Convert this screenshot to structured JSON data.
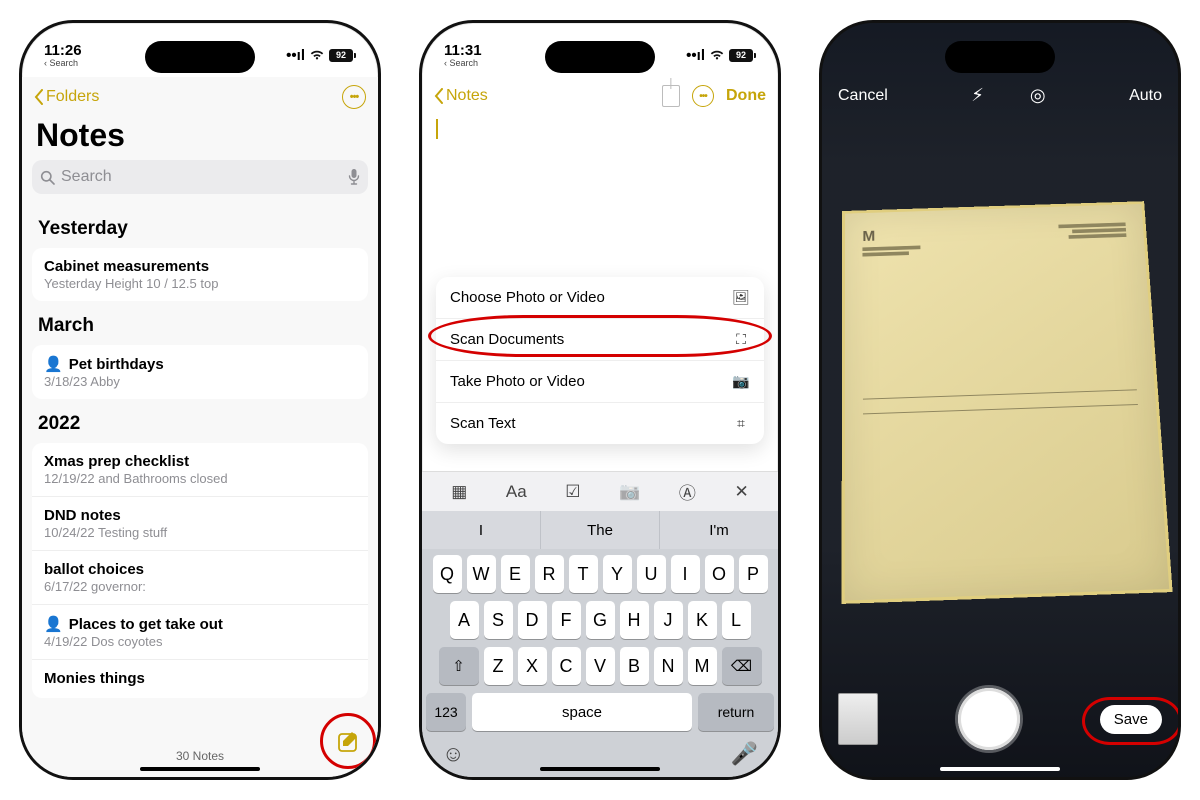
{
  "phone1": {
    "status": {
      "time": "11:26",
      "back_hint": "Search",
      "battery": "92"
    },
    "nav": {
      "back": "Folders"
    },
    "title": "Notes",
    "search_placeholder": "Search",
    "sections": [
      {
        "header": "Yesterday",
        "rows": [
          {
            "title": "Cabinet measurements",
            "sub": "Yesterday  Height 10 / 12.5 top",
            "shared": false
          }
        ]
      },
      {
        "header": "March",
        "rows": [
          {
            "title": "Pet birthdays",
            "sub": "3/18/23  Abby",
            "shared": true
          }
        ]
      },
      {
        "header": "2022",
        "rows": [
          {
            "title": "Xmas prep checklist",
            "sub": "12/19/22  and Bathrooms closed",
            "shared": false
          },
          {
            "title": "DND notes",
            "sub": "10/24/22  Testing stuff",
            "shared": false
          },
          {
            "title": "ballot choices",
            "sub": "6/17/22  governor:",
            "shared": false
          },
          {
            "title": "Places to get take out",
            "sub": "4/19/22  Dos coyotes",
            "shared": true
          },
          {
            "title": "Monies things",
            "sub": "",
            "shared": false
          }
        ]
      }
    ],
    "footer_count": "30 Notes"
  },
  "phone2": {
    "status": {
      "time": "11:31",
      "back_hint": "Search",
      "battery": "92"
    },
    "nav": {
      "back": "Notes",
      "done": "Done"
    },
    "menu": [
      {
        "label": "Choose Photo or Video"
      },
      {
        "label": "Scan Documents"
      },
      {
        "label": "Take Photo or Video"
      },
      {
        "label": "Scan Text"
      }
    ],
    "toolbar_aa": "Aa",
    "suggestions": [
      "I",
      "The",
      "I'm"
    ],
    "kbd_rows": {
      "r1": [
        "Q",
        "W",
        "E",
        "R",
        "T",
        "Y",
        "U",
        "I",
        "O",
        "P"
      ],
      "r2": [
        "A",
        "S",
        "D",
        "F",
        "G",
        "H",
        "J",
        "K",
        "L"
      ],
      "r3_mid": [
        "Z",
        "X",
        "C",
        "V",
        "B",
        "N",
        "M"
      ]
    },
    "kbd_space": "space",
    "kbd_return": "return",
    "kbd_123": "123"
  },
  "phone3": {
    "nav": {
      "cancel": "Cancel",
      "auto": "Auto"
    },
    "save": "Save",
    "doc_logo": "M"
  }
}
